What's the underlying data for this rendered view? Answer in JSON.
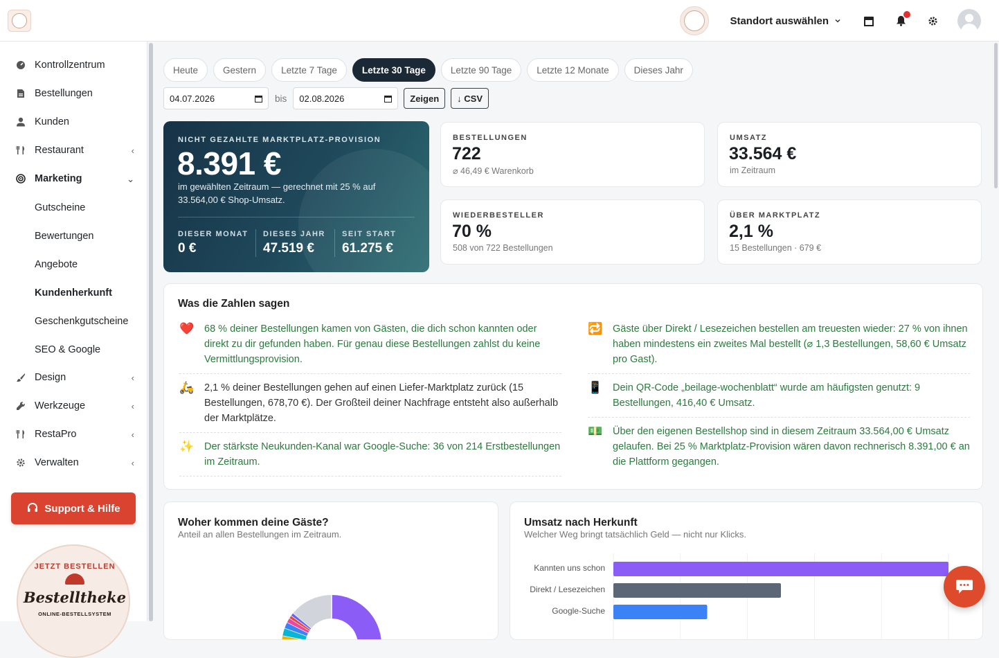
{
  "header": {
    "location_label": "Standort auswählen"
  },
  "sidebar": {
    "items": [
      {
        "label": "Kontrollzentrum",
        "icon": "gauge-icon"
      },
      {
        "label": "Bestellungen",
        "icon": "file-icon"
      },
      {
        "label": "Kunden",
        "icon": "user-icon"
      },
      {
        "label": "Restaurant",
        "icon": "utensils-icon"
      },
      {
        "label": "Marketing",
        "icon": "target-icon"
      },
      {
        "label": "Design",
        "icon": "brush-icon"
      },
      {
        "label": "Werkzeuge",
        "icon": "wrench-icon"
      },
      {
        "label": "RestaPro",
        "icon": "utensils-icon"
      },
      {
        "label": "Verwalten",
        "icon": "gear-icon"
      }
    ],
    "marketing_sub": [
      "Gutscheine",
      "Bewertungen",
      "Angebote",
      "Kundenherkunft",
      "Geschenkgutscheine",
      "SEO & Google"
    ],
    "support_label": "Support & Hilfe",
    "brand": {
      "arc": "JETZT BESTELLEN",
      "name": "Bestelltheke",
      "sub": "ONLINE-BESTELLSYSTEM"
    }
  },
  "filters": {
    "pills": [
      "Heute",
      "Gestern",
      "Letzte 7 Tage",
      "Letzte 30 Tage",
      "Letzte 90 Tage",
      "Letzte 12 Monate",
      "Dieses Jahr"
    ],
    "active_index": 3,
    "date_from": "04.07.2026",
    "bis": "bis",
    "date_to": "02.08.2026",
    "show_label": "Zeigen",
    "csv_label": "↓ CSV"
  },
  "hero": {
    "label": "NICHT GEZAHLTE MARKTPLATZ-PROVISION",
    "value": "8.391 €",
    "desc": "im gewählten Zeitraum — gerechnet mit 25 % auf 33.564,00 € Shop-Umsatz.",
    "stats": [
      {
        "label": "DIESER MONAT",
        "value": "0 €"
      },
      {
        "label": "DIESES JAHR",
        "value": "47.519 €"
      },
      {
        "label": "SEIT START",
        "value": "61.275 €"
      }
    ]
  },
  "kpis": [
    {
      "label": "BESTELLUNGEN",
      "value": "722",
      "sub": "⌀ 46,49 € Warenkorb"
    },
    {
      "label": "UMSATZ",
      "value": "33.564 €",
      "sub": "im Zeitraum"
    },
    {
      "label": "WIEDERBESTELLER",
      "value": "70 %",
      "sub": "508 von 722 Bestellungen"
    },
    {
      "label": "ÜBER MARKTPLATZ",
      "value": "2,1 %",
      "sub": "15 Bestellungen · 679 €"
    }
  ],
  "insights": {
    "title": "Was die Zahlen sagen",
    "left": [
      {
        "icon": "❤️",
        "text": "68 % deiner Bestellungen kamen von Gästen, die dich schon kannten oder direkt zu dir gefunden haben. Für genau diese Bestellungen zahlst du keine Vermittlungsprovision."
      },
      {
        "icon": "🛵",
        "text": "2,1 % deiner Bestellungen gehen auf einen Liefer-Marktplatz zurück (15 Bestellungen, 678,70 €). Der Großteil deiner Nachfrage entsteht also außerhalb der Marktplätze."
      },
      {
        "icon": "✨",
        "text": "Der stärkste Neukunden-Kanal war Google-Suche: 36 von 214 Erstbestellungen im Zeitraum."
      }
    ],
    "right": [
      {
        "icon": "🔁",
        "text": "Gäste über Direkt / Lesezeichen bestellen am treuesten wieder: 27 % von ihnen haben mindestens ein zweites Mal bestellt (⌀ 1,3 Bestellungen, 58,60 € Umsatz pro Gast)."
      },
      {
        "icon": "📱",
        "text": "Dein QR-Code „beilage-wochenblatt“ wurde am häufigsten genutzt: 9 Bestellungen, 416,40 € Umsatz."
      },
      {
        "icon": "💵",
        "text": "Über den eigenen Bestellshop sind in diesem Zeitraum 33.564,00 € Umsatz gelaufen. Bei 25 % Marktplatz-Provision wären davon rechnerisch 8.391,00 € an die Plattform gegangen."
      }
    ]
  },
  "guests_card": {
    "title": "Woher kommen deine Gäste?",
    "subtitle": "Anteil an allen Bestellungen im Zeitraum."
  },
  "revenue_card": {
    "title": "Umsatz nach Herkunft",
    "subtitle": "Welcher Weg bringt tatsächlich Geld — nicht nur Klicks."
  },
  "chart_data": [
    {
      "type": "pie",
      "title": "Woher kommen deine Gäste?",
      "values": [
        40,
        22,
        7,
        3,
        3,
        3,
        2.5,
        2,
        1.5,
        1,
        1,
        14
      ],
      "colors": [
        "#8b5cf6",
        "#5b6677",
        "#3b82f6",
        "#22c55e",
        "#f97316",
        "#eab308",
        "#06b6d4",
        "#3b82f6",
        "#ec4899",
        "#ef4444",
        "#6366f1",
        "#d1d5db"
      ]
    },
    {
      "type": "bar",
      "title": "Umsatz nach Herkunft",
      "categories": [
        "Kannten uns schon",
        "Direkt / Lesezeichen",
        "Google-Suche"
      ],
      "values": [
        100,
        50,
        28
      ],
      "colors": [
        "#8b5cf6",
        "#5b6677",
        "#3b82f6"
      ],
      "xlim": [
        0,
        100
      ]
    }
  ]
}
